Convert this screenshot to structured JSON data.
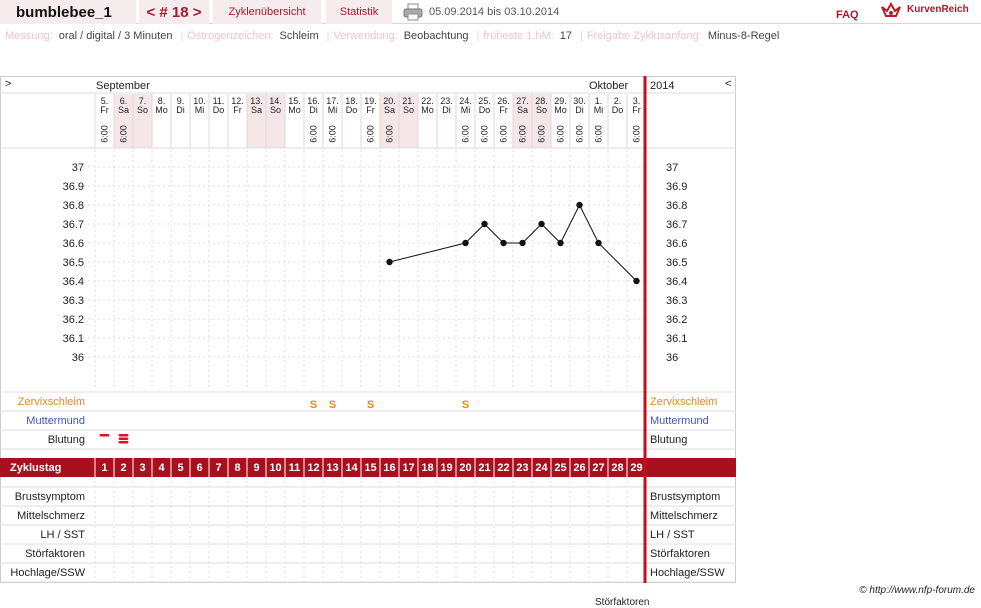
{
  "topbar": {
    "username": "bumblebee_1",
    "cycle_nav": "< # 18 >",
    "zyklen_tab": "Zyklenübersicht",
    "statistik_tab": "Statistik",
    "date_range": "05.09.2014 bis 03.10.2014",
    "faq": "FAQ",
    "logo_text": "KurvenReich"
  },
  "info": [
    {
      "key": "Messung:",
      "value": "oral / digital / 3 Minuten"
    },
    {
      "key": "Östrogenzeichen:",
      "value": "Schleim"
    },
    {
      "key": "Verwendung:",
      "value": "Beobachtung"
    },
    {
      "key": "früheste 1.hM:",
      "value": "17"
    },
    {
      "key": "Freigabe Zyklusanfang:",
      "value": "Minus-8-Regel"
    }
  ],
  "header": {
    "left_arrow": ">",
    "right_arrow": "<",
    "month1": "September",
    "month2": "Oktober",
    "year": "2014"
  },
  "chart_data": {
    "type": "line",
    "x": [
      "5.",
      "6.",
      "7.",
      "8.",
      "9.",
      "10.",
      "11.",
      "12.",
      "13.",
      "14.",
      "15.",
      "16.",
      "17.",
      "18.",
      "19.",
      "20.",
      "21.",
      "22.",
      "23.",
      "24.",
      "25.",
      "26.",
      "27.",
      "28.",
      "29.",
      "30.",
      "1.",
      "2.",
      "3."
    ],
    "weekdays": [
      "Fr",
      "Sa",
      "So",
      "Mo",
      "Di",
      "Mi",
      "Do",
      "Fr",
      "Sa",
      "So",
      "Mo",
      "Di",
      "Mi",
      "Do",
      "Fr",
      "Sa",
      "So",
      "Mo",
      "Di",
      "Mi",
      "Do",
      "Fr",
      "Sa",
      "So",
      "Mo",
      "Di",
      "Mi",
      "Do",
      "Fr"
    ],
    "times": [
      "6:00",
      "6:00",
      "",
      "",
      "",
      "",
      "",
      "",
      "",
      "",
      "",
      "6:00",
      "6:00",
      "",
      "6:00",
      "6:00",
      "",
      "",
      "",
      "6:00",
      "6:00",
      "6:00",
      "6:00",
      "6:00",
      "6:00",
      "6:00",
      "6:00",
      "",
      "6:00"
    ],
    "series": [
      {
        "values": [
          null,
          null,
          null,
          null,
          null,
          null,
          null,
          null,
          null,
          null,
          null,
          null,
          null,
          null,
          null,
          36.5,
          null,
          null,
          null,
          36.6,
          36.7,
          36.6,
          36.6,
          36.7,
          36.6,
          36.8,
          36.6,
          null,
          36.4
        ]
      }
    ],
    "ylim": [
      36.0,
      37.0
    ],
    "yticks": [
      "37",
      "36.9",
      "36.8",
      "36.7",
      "36.6",
      "36.5",
      "36.4",
      "36.3",
      "36.2",
      "36.1",
      "36"
    ],
    "row_labels": {
      "zervix": "Zervixschleim",
      "muttermund": "Muttermund",
      "blutung": "Blutung",
      "zyklustag": "Zyklustag",
      "brust": "Brustsymptom",
      "mittel": "Mittelschmerz",
      "lh": "LH / SST",
      "stoer": "Störfaktoren",
      "hoch": "Hochlage/SSW"
    },
    "zervix": [
      "",
      "",
      "",
      "",
      "",
      "",
      "",
      "",
      "",
      "",
      "",
      "S",
      "S",
      "",
      "S",
      "",
      "",
      "",
      "",
      "S",
      "",
      "",
      "",
      "",
      "",
      "",
      "",
      "",
      ""
    ],
    "blutung": [
      1,
      3,
      0,
      0,
      0,
      0,
      0,
      0,
      0,
      0,
      0,
      0,
      0,
      0,
      0,
      0,
      0,
      0,
      0,
      0,
      0,
      0,
      0,
      0,
      0,
      0,
      0,
      0,
      0
    ],
    "zyklustag": [
      "1",
      "2",
      "3",
      "4",
      "5",
      "6",
      "7",
      "8",
      "9",
      "10",
      "11",
      "12",
      "13",
      "14",
      "15",
      "16",
      "17",
      "18",
      "19",
      "20",
      "21",
      "22",
      "23",
      "24",
      "25",
      "26",
      "27",
      "28",
      "29"
    ]
  },
  "footer": "© http://www.nfp-forum.de",
  "cut_text": "Störfaktoren"
}
